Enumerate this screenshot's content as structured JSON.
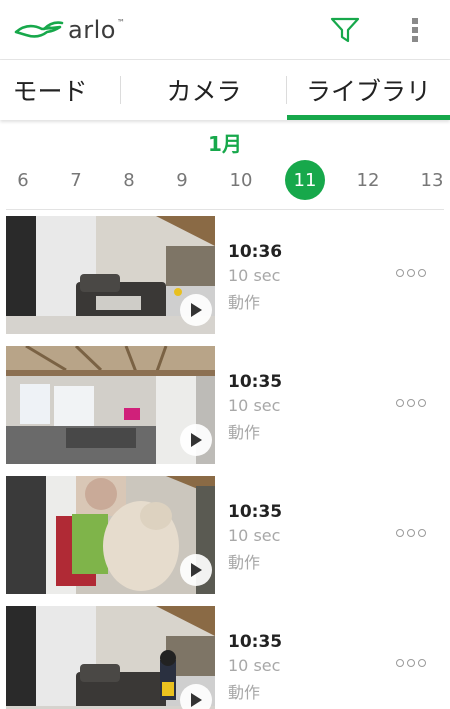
{
  "header": {
    "logo_text": "arlo",
    "logo_tm": "™",
    "brand_color": "#17a84b",
    "filter_icon": "filter-icon",
    "menu_icon": "more-vertical-icon"
  },
  "tabs": [
    {
      "label": "モード",
      "active": false
    },
    {
      "label": "カメラ",
      "active": false
    },
    {
      "label": "ライブラリ",
      "active": true
    }
  ],
  "calendar": {
    "month": "1月",
    "dates": [
      "6",
      "7",
      "8",
      "9",
      "10",
      "11",
      "12",
      "13"
    ],
    "selected": "11"
  },
  "recordings": [
    {
      "time": "10:36",
      "duration": "10 sec",
      "type": "動作",
      "scene": "living-room"
    },
    {
      "time": "10:35",
      "duration": "10 sec",
      "type": "動作",
      "scene": "ceiling-room"
    },
    {
      "time": "10:35",
      "duration": "10 sec",
      "type": "動作",
      "scene": "child-closeup"
    },
    {
      "time": "10:35",
      "duration": "10 sec",
      "type": "動作",
      "scene": "living-room-child"
    }
  ]
}
